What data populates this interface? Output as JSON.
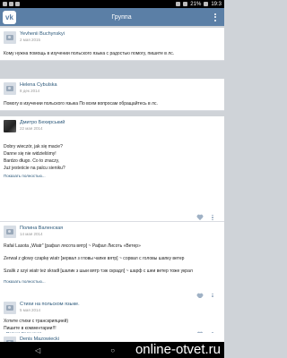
{
  "statusbar": {
    "battery": "21%",
    "time": "19:3"
  },
  "appbar": {
    "title": "Группа",
    "logo": "vk"
  },
  "posts": [
    {
      "author": "Yevhenii Buchynskyi",
      "date": "2 мая 2015",
      "text": "Кому нужна помощь в изучении польского языка с радостью помогу, пишите в лс."
    },
    {
      "author": "Helena Cybulska",
      "date": "8 дек 2014",
      "text": "Помогу в изучении польского языка По всем вопросам обращайтесь в лс."
    },
    {
      "author": "Дмитро Бехирський",
      "date": "22 мая 2014",
      "lines": [
        "Dobry wieczór, jak się macie?",
        "Danne się nie widzieliśmy!",
        "Bardzo długo. Co to znaczy,",
        "Już jesteście na palcu sieniku?"
      ],
      "more": "Показать полностью..."
    },
    {
      "author": "Полина Валенская",
      "date": "14 мая 2014",
      "lines": [
        "Rafał Lasota „Wiatr\" [рафал лясота вятр] ~ Рафал Лисоть «Ветер»",
        "",
        "Zerwał z głowy czapkę wiatr [зервал з гловы чапке вятр] ~ сорвал с головы шапку ветер",
        "",
        "Szalik z szyi wiatr też skradł [шалик з шыи вятр тэж скрадл] ~ шарф с шеи ветер тоже украл"
      ],
      "more": "Показать полностью..."
    },
    {
      "author": "Стихи на польском языке.",
      "date": "5 мая 2014",
      "lines": [
        "Хотите стихи с транскрипцией)",
        "Пишите в комментарии!!!"
      ],
      "signed": "Полина Валенская"
    },
    {
      "author": "Denis Mazowiecki",
      "date": "",
      "lines": []
    }
  ],
  "navbar": {
    "back": "◁",
    "home": "○",
    "recent": "□"
  },
  "watermark": "online-otvet.ru"
}
